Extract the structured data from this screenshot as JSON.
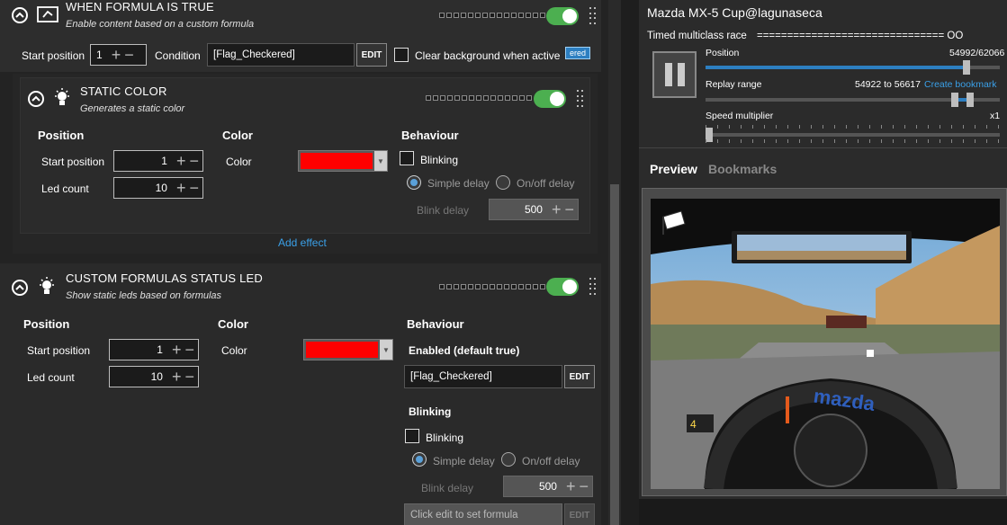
{
  "formula_card": {
    "title": "WHEN FORMULA IS TRUE",
    "subtitle": "Enable content based on a custom formula",
    "start_position_label": "Start position",
    "start_position_value": "1",
    "condition_label": "Condition",
    "condition_value": "[Flag_Checkered]",
    "edit_label": "EDIT",
    "clear_bg_label": "Clear background when active",
    "partial_tag": "ered"
  },
  "static_color": {
    "title": "STATIC COLOR",
    "subtitle": "Generates a static color",
    "position_heading": "Position",
    "start_position_label": "Start position",
    "start_position_value": "1",
    "led_count_label": "Led count",
    "led_count_value": "10",
    "color_heading": "Color",
    "color_label": "Color",
    "color_hex": "#ff0000",
    "behaviour_heading": "Behaviour",
    "blinking_label": "Blinking",
    "simple_delay_label": "Simple delay",
    "onoff_delay_label": "On/off delay",
    "blink_delay_label": "Blink delay",
    "blink_delay_value": "500",
    "add_effect_label": "Add effect"
  },
  "custom_leds": {
    "title": "CUSTOM FORMULAS STATUS LED",
    "subtitle": "Show static leds based on formulas",
    "position_heading": "Position",
    "start_position_label": "Start position",
    "start_position_value": "1",
    "led_count_label": "Led count",
    "led_count_value": "10",
    "color_heading": "Color",
    "color_label": "Color",
    "color_hex": "#ff0000",
    "behaviour_heading": "Behaviour",
    "enabled_label": "Enabled (default true)",
    "enabled_formula": "[Flag_Checkered]",
    "edit_label": "EDIT",
    "blinking_heading": "Blinking",
    "blinking_label": "Blinking",
    "simple_delay_label": "Simple delay",
    "onoff_delay_label": "On/off delay",
    "blink_delay_label": "Blink delay",
    "blink_delay_value": "500",
    "formula_placeholder": "Click edit to set formula",
    "edit2_label": "EDIT"
  },
  "replay": {
    "title": "Mazda MX-5 Cup@lagunaseca",
    "session": "Timed multiclass race",
    "session_bar": "=============================== OO",
    "position_label": "Position",
    "position_value": "54992/62066",
    "position_fraction": 0.886,
    "range_label": "Replay range",
    "range_value": "54922 to 56617",
    "create_bookmark": "Create bookmark",
    "speed_label": "Speed multiplier",
    "speed_value": "x1"
  },
  "tabs": {
    "preview": "Preview",
    "bookmarks": "Bookmarks"
  },
  "colors": {
    "accent": "#2d7fc1",
    "toggle_on": "#4caf50",
    "link": "#3aa0e8"
  }
}
